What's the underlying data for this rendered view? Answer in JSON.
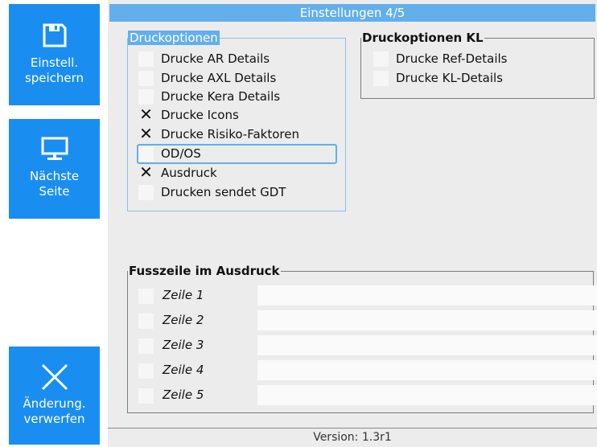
{
  "sidebar": {
    "save": {
      "line1": "Einstell.",
      "line2": "speichern",
      "icon": "floppy-disk-icon"
    },
    "next": {
      "line1": "Nächste",
      "line2": "Seite",
      "icon": "monitor-icon"
    },
    "discard": {
      "line1": "Änderung.",
      "line2": "verwerfen",
      "icon": "close-x-icon"
    }
  },
  "window": {
    "title": "Einstellungen 4/5",
    "status": "Version: 1.3r1",
    "accent": "#1a8ef0",
    "title_bg": "#63afec"
  },
  "druckoptionen": {
    "legend": "Druckoptionen",
    "items": [
      {
        "label": "Drucke AR Details",
        "checked": false
      },
      {
        "label": "Drucke AXL Details",
        "checked": false
      },
      {
        "label": "Drucke Kera Details",
        "checked": false
      },
      {
        "label": "Drucke Icons",
        "checked": true
      },
      {
        "label": "Drucke Risiko-Faktoren",
        "checked": true
      },
      {
        "label": "OD/OS",
        "checked": false,
        "focused": true
      },
      {
        "label": "Ausdruck",
        "checked": true
      },
      {
        "label": "Drucken sendet GDT",
        "checked": false
      }
    ]
  },
  "druckoptionen_kl": {
    "legend": "Druckoptionen KL",
    "items": [
      {
        "label": "Drucke Ref-Details",
        "checked": false
      },
      {
        "label": "Drucke KL-Details",
        "checked": false
      }
    ]
  },
  "fusszeile": {
    "legend": "Fusszeile im Ausdruck",
    "rows": [
      {
        "label": "Zeile 1",
        "checked": false,
        "value": ""
      },
      {
        "label": "Zeile 2",
        "checked": false,
        "value": ""
      },
      {
        "label": "Zeile 3",
        "checked": false,
        "value": ""
      },
      {
        "label": "Zeile 4",
        "checked": false,
        "value": ""
      },
      {
        "label": "Zeile 5",
        "checked": false,
        "value": ""
      }
    ]
  }
}
